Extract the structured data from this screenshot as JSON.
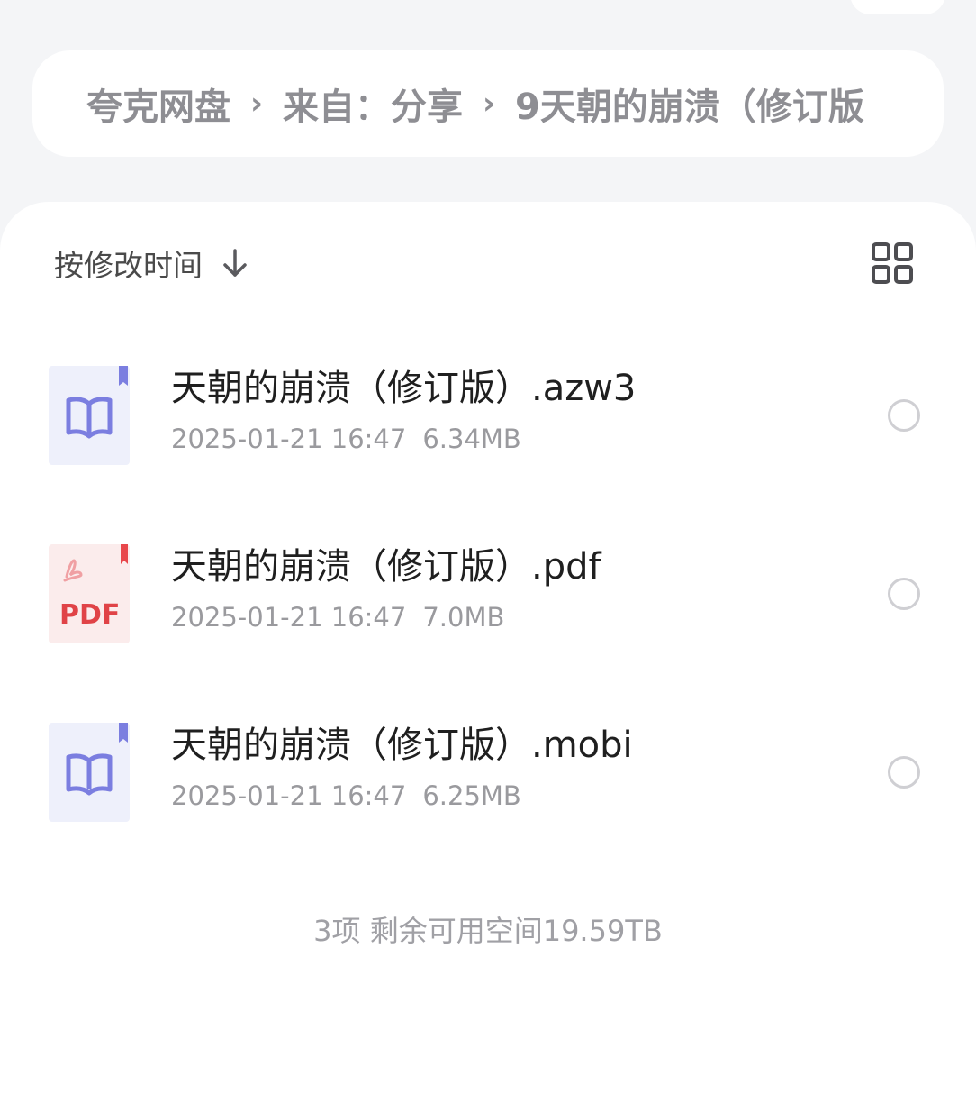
{
  "breadcrumb": {
    "root": "夸克网盘",
    "folder": "来自：分享",
    "current": "9天朝的崩溃（修订版"
  },
  "toolbar": {
    "sort_label": "按修改时间",
    "sort_icon": "arrow-down-icon",
    "view_icon": "grid-view-icon"
  },
  "files": [
    {
      "name": "天朝的崩溃（修订版）.azw3",
      "date": "2025-01-21 16:47",
      "size": "6.34MB",
      "icon": "ebook-icon"
    },
    {
      "name": "天朝的崩溃（修订版）.pdf",
      "date": "2025-01-21 16:47",
      "size": "7.0MB",
      "icon": "pdf-icon",
      "icon_text": "PDF"
    },
    {
      "name": "天朝的崩溃（修订版）.mobi",
      "date": "2025-01-21 16:47",
      "size": "6.25MB",
      "icon": "ebook-icon"
    }
  ],
  "footer": {
    "summary": "3项 剩余可用空间19.59TB"
  },
  "colors": {
    "ebook_accent": "#7b7ee0",
    "pdf_accent": "#e8474b",
    "page_background": "#f4f5f7"
  }
}
